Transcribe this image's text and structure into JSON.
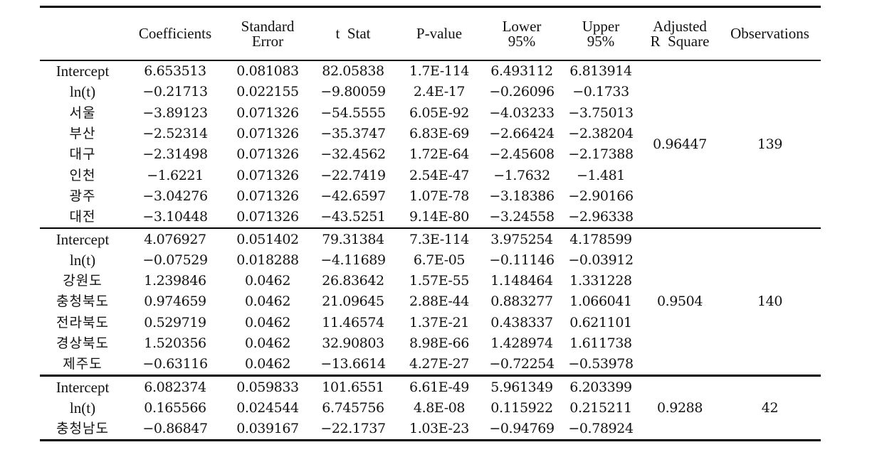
{
  "table": {
    "headers": [
      {
        "key": "label",
        "text": ""
      },
      {
        "key": "coef",
        "text": "Coefficients"
      },
      {
        "key": "se",
        "text": "Standard\nError"
      },
      {
        "key": "t",
        "text": "t  Stat"
      },
      {
        "key": "p",
        "text": "P-value"
      },
      {
        "key": "lo",
        "text": "Lower\n95%"
      },
      {
        "key": "up",
        "text": "Upper\n95%"
      },
      {
        "key": "r2",
        "text": "Adjusted\nR  Square"
      },
      {
        "key": "obs",
        "text": "Observations"
      }
    ],
    "groups": [
      {
        "adj_r_square": "0.96447",
        "observations": "139",
        "rows": [
          {
            "label": "Intercept",
            "coef": "6.653513",
            "se": "0.081083",
            "t": "82.05838",
            "p": "1.7E-114",
            "lo": "6.493112",
            "up": "6.813914"
          },
          {
            "label": "ln(t)",
            "coef": "−0.21713",
            "se": "0.022155",
            "t": "−9.80059",
            "p": "2.4E-17",
            "lo": "−0.26096",
            "up": "−0.1733"
          },
          {
            "label": "서울",
            "coef": "−3.89123",
            "se": "0.071326",
            "t": "−54.5555",
            "p": "6.05E-92",
            "lo": "−4.03233",
            "up": "−3.75013"
          },
          {
            "label": "부산",
            "coef": "−2.52314",
            "se": "0.071326",
            "t": "−35.3747",
            "p": "6.83E-69",
            "lo": "−2.66424",
            "up": "−2.38204"
          },
          {
            "label": "대구",
            "coef": "−2.31498",
            "se": "0.071326",
            "t": "−32.4562",
            "p": "1.72E-64",
            "lo": "−2.45608",
            "up": "−2.17388"
          },
          {
            "label": "인천",
            "coef": "−1.6221",
            "se": "0.071326",
            "t": "−22.7419",
            "p": "2.54E-47",
            "lo": "−1.7632",
            "up": "−1.481"
          },
          {
            "label": "광주",
            "coef": "−3.04276",
            "se": "0.071326",
            "t": "−42.6597",
            "p": "1.07E-78",
            "lo": "−3.18386",
            "up": "−2.90166"
          },
          {
            "label": "대전",
            "coef": "−3.10448",
            "se": "0.071326",
            "t": "−43.5251",
            "p": "9.14E-80",
            "lo": "−3.24558",
            "up": "−2.96338"
          }
        ]
      },
      {
        "adj_r_square": "0.9504",
        "observations": "140",
        "rows": [
          {
            "label": "Intercept",
            "coef": "4.076927",
            "se": "0.051402",
            "t": "79.31384",
            "p": "7.3E-114",
            "lo": "3.975254",
            "up": "4.178599"
          },
          {
            "label": "ln(t)",
            "coef": "−0.07529",
            "se": "0.018288",
            "t": "−4.11689",
            "p": "6.7E-05",
            "lo": "−0.11146",
            "up": "−0.03912"
          },
          {
            "label": "강원도",
            "coef": "1.239846",
            "se": "0.0462",
            "t": "26.83642",
            "p": "1.57E-55",
            "lo": "1.148464",
            "up": "1.331228"
          },
          {
            "label": "충청북도",
            "coef": "0.974659",
            "se": "0.0462",
            "t": "21.09645",
            "p": "2.88E-44",
            "lo": "0.883277",
            "up": "1.066041"
          },
          {
            "label": "전라북도",
            "coef": "0.529719",
            "se": "0.0462",
            "t": "11.46574",
            "p": "1.37E-21",
            "lo": "0.438337",
            "up": "0.621101"
          },
          {
            "label": "경상북도",
            "coef": "1.520356",
            "se": "0.0462",
            "t": "32.90803",
            "p": "8.98E-66",
            "lo": "1.428974",
            "up": "1.611738"
          },
          {
            "label": "제주도",
            "coef": "−0.63116",
            "se": "0.0462",
            "t": "−13.6614",
            "p": "4.27E-27",
            "lo": "−0.72254",
            "up": "−0.53978"
          }
        ]
      },
      {
        "adj_r_square": "0.9288",
        "observations": "42",
        "rows": [
          {
            "label": "Intercept",
            "coef": "6.082374",
            "se": "0.059833",
            "t": "101.6551",
            "p": "6.61E-49",
            "lo": "5.961349",
            "up": "6.203399"
          },
          {
            "label": "ln(t)",
            "coef": "0.165566",
            "se": "0.024544",
            "t": "6.745756",
            "p": "4.8E-08",
            "lo": "0.115922",
            "up": "0.215211"
          },
          {
            "label": "충청남도",
            "coef": "−0.86847",
            "se": "0.039167",
            "t": "−22.1737",
            "p": "1.03E-23",
            "lo": "−0.94769",
            "up": "−0.78924"
          }
        ]
      }
    ]
  }
}
